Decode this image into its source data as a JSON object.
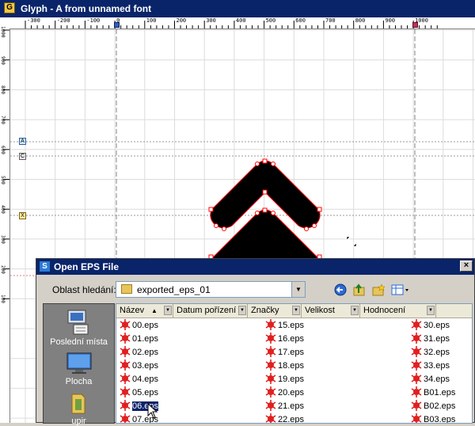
{
  "window": {
    "app_icon_letter": "G",
    "title": "Glyph - A from unnamed font"
  },
  "ruler_top_labels": [
    "-300",
    "-200",
    "-100",
    "0",
    "100",
    "200",
    "300",
    "400",
    "500",
    "600",
    "700",
    "800",
    "900",
    "1000"
  ],
  "ruler_left_labels": [
    "1000",
    "900",
    "800",
    "700",
    "600",
    "500",
    "400",
    "300",
    "200",
    "100"
  ],
  "guide_markers": [
    "A",
    "C",
    "X"
  ],
  "dialog": {
    "icon_letter": "S",
    "title": "Open EPS File",
    "close_label": "×",
    "lookin_label": "Oblast hledání:",
    "lookin_value": "exported_eps_01",
    "toolbar": {
      "back_icon": "back-icon",
      "up_icon": "up-folder-icon",
      "new_folder_icon": "new-folder-icon",
      "view_icon": "view-menu-icon"
    },
    "places": [
      {
        "label": "Poslední místa",
        "icon": "recent-places-icon"
      },
      {
        "label": "Plocha",
        "icon": "desktop-icon"
      },
      {
        "label": "upir",
        "icon": "user-folder-icon"
      }
    ],
    "columns": [
      "Název",
      "Datum pořízení",
      "Značky",
      "Velikost",
      "Hodnocení"
    ],
    "files": {
      "col1": [
        "00.eps",
        "01.eps",
        "02.eps",
        "03.eps",
        "04.eps",
        "05.eps",
        "06.eps",
        "07.eps"
      ],
      "col2": [
        "15.eps",
        "16.eps",
        "17.eps",
        "18.eps",
        "19.eps",
        "20.eps",
        "21.eps",
        "22.eps"
      ],
      "col3": [
        "30.eps",
        "31.eps",
        "32.eps",
        "33.eps",
        "34.eps",
        "B01.eps",
        "B02.eps",
        "B03.eps"
      ]
    },
    "selected_file": "06.eps"
  },
  "colors": {
    "titlebar": "#0a246a",
    "glyph_fill": "#000000",
    "glyph_outline": "#ff0000",
    "file_icon": "#e02020"
  }
}
